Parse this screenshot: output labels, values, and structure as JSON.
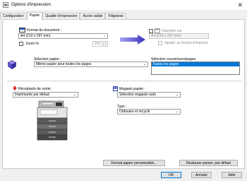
{
  "window": {
    "title": "Options d'impression",
    "close": "✕"
  },
  "tabs": [
    "Configuration",
    "Papier",
    "Qualité d'impression",
    "Accès valide",
    "Filigranes"
  ],
  "format": {
    "label": "Format du document :",
    "value": "A4 (210 x 297 mm)",
    "zoom_label": "Zoom %",
    "zoom_value": "100"
  },
  "print_on": {
    "label": "Imprimer sur",
    "value": "A4 (210 x 297 mm)",
    "adjust_label": "Ajuster au format d'impress."
  },
  "paper_selection": {
    "label": "Sélection papier :",
    "value": "Même papier pour toutes les pages"
  },
  "cover_selection": {
    "label": "Sélection couvertures/pages",
    "items": [
      "Toutes les pages"
    ]
  },
  "output_tray": {
    "label": "Réceptacle de sortie :",
    "value": "Imprimante par défaut"
  },
  "paper_tray": {
    "label": "Magasin papier :",
    "value": "Sélection magasin auto"
  },
  "paper_type": {
    "label": "Type :",
    "value": "Ordinaire et recyclé"
  },
  "buttons": {
    "custom_format": "Format papier personnalisé...",
    "restore_defaults": "Restaurer param. par défaut",
    "ok": "OK",
    "cancel": "Annuler",
    "help": "Aide"
  },
  "colors": {
    "accent": "#0078d7",
    "arrow": "#5b4fd0",
    "red_arrow": "#e02020"
  }
}
